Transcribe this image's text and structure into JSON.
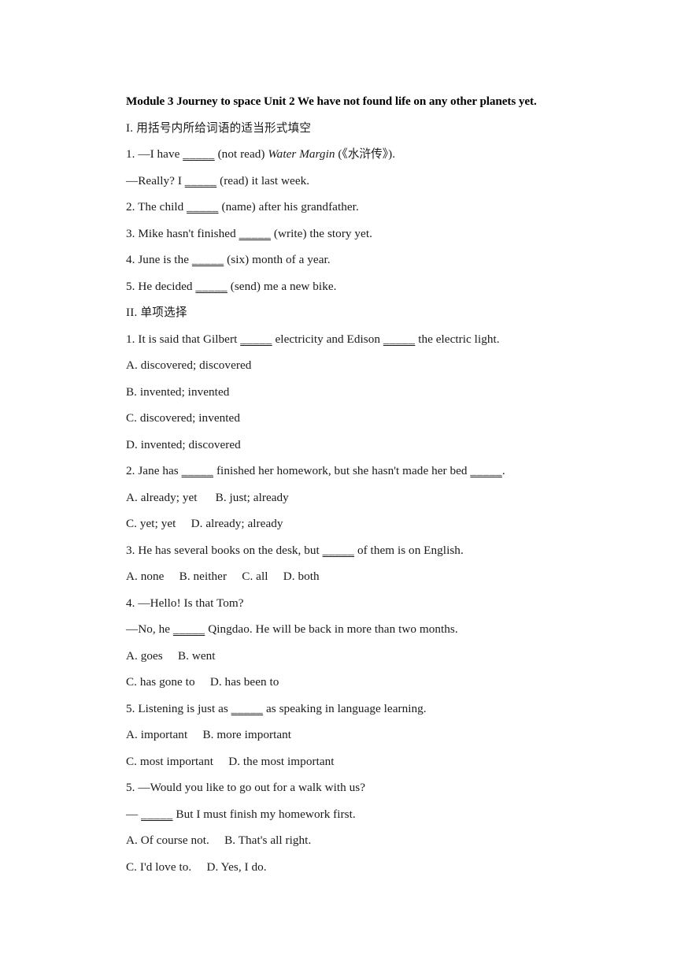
{
  "document": {
    "title": "Module 3 Journey to space Unit 2 We have not found life on any other planets yet.",
    "blank": "_____",
    "sections": [
      {
        "heading": "I. 用括号内所给词语的适当形式填空",
        "lines": [
          {
            "id": "s1-q1a",
            "pre": "1. —I have ",
            "blank": true,
            "post_plain": " (not read) ",
            "italic": "Water Margin",
            "post2": " (《水浒传》)."
          },
          {
            "id": "s1-q1b",
            "pre": "—Really? I ",
            "blank": true,
            "post_plain": " (read) it last week."
          },
          {
            "id": "s1-q2",
            "pre": "2. The child ",
            "blank": true,
            "post_plain": " (name) after his grandfather."
          },
          {
            "id": "s1-q3",
            "pre": "3. Mike hasn't finished ",
            "blank": true,
            "post_plain": " (write) the story yet."
          },
          {
            "id": "s1-q4",
            "pre": "4. June is the ",
            "blank": true,
            "post_plain": " (six) month of a year."
          },
          {
            "id": "s1-q5",
            "pre": "5. He decided ",
            "blank": true,
            "post_plain": " (send) me a new bike."
          }
        ]
      },
      {
        "heading": "II. 单项选择",
        "lines": [
          {
            "id": "s2-q1",
            "pre": "1. It is said that Gilbert ",
            "blank": true,
            "post_plain": " electricity and Edison ",
            "blank2": true,
            "post2": " the electric light."
          },
          {
            "id": "s2-q1-a",
            "pre": "A. discovered; discovered"
          },
          {
            "id": "s2-q1-b",
            "pre": "B. invented; invented"
          },
          {
            "id": "s2-q1-c",
            "pre": "C. discovered; invented"
          },
          {
            "id": "s2-q1-d",
            "pre": "D. invented; discovered"
          },
          {
            "id": "s2-q2",
            "pre": "2. Jane has ",
            "blank": true,
            "post_plain": " finished her homework, but she hasn't made her bed ",
            "blank2": true,
            "post2": "."
          },
          {
            "id": "s2-q2-ab",
            "pre": "A. already; yet      B. just; already"
          },
          {
            "id": "s2-q2-cd",
            "pre": "C. yet; yet     D. already; already"
          },
          {
            "id": "s2-q3",
            "pre": "3. He has several books on the desk, but ",
            "blank": true,
            "post_plain": " of them is on English."
          },
          {
            "id": "s2-q3-abcd",
            "pre": "A. none     B. neither     C. all     D. both"
          },
          {
            "id": "s2-q4a",
            "pre": "4. —Hello! Is that Tom?"
          },
          {
            "id": "s2-q4b",
            "pre": "—No, he ",
            "blank": true,
            "post_plain": " Qingdao. He will be back in more than two months."
          },
          {
            "id": "s2-q4-ab",
            "pre": "A. goes     B. went"
          },
          {
            "id": "s2-q4-cd",
            "pre": "C. has gone to     D. has been to"
          },
          {
            "id": "s2-q5",
            "pre": "5. Listening is just as ",
            "blank": true,
            "post_plain": " as speaking in language learning."
          },
          {
            "id": "s2-q5-ab",
            "pre": "A. important     B. more important"
          },
          {
            "id": "s2-q5-cd",
            "pre": "C. most important     D. the most important"
          },
          {
            "id": "s2-q6a",
            "pre": "5. —Would you like to go out for a walk with us?"
          },
          {
            "id": "s2-q6b",
            "pre": "— ",
            "blank": true,
            "post_plain": " But I must finish my homework first."
          },
          {
            "id": "s2-q6-ab",
            "pre": "A. Of course not.     B. That's all right."
          },
          {
            "id": "s2-q6-cd",
            "pre": "C. I'd love to.     D. Yes, I do."
          }
        ]
      }
    ]
  }
}
